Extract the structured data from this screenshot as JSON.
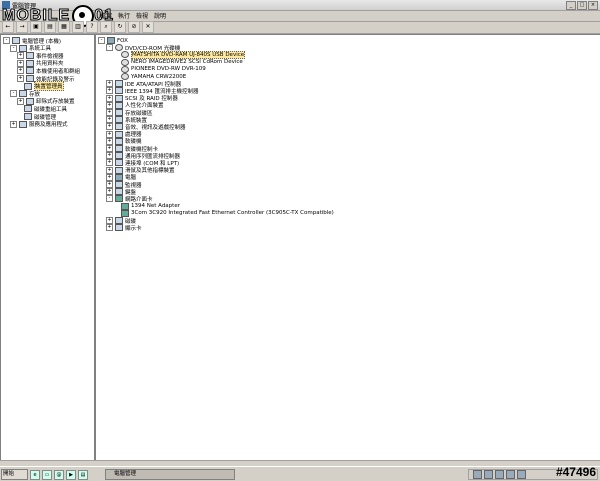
{
  "window": {
    "title": "電腦管理"
  },
  "logo": {
    "text": "MOBILE",
    "suffix": "01"
  },
  "menu": [
    "檔案",
    "執行",
    "檢視",
    "說明"
  ],
  "left_tree": [
    {
      "label": "電腦管理 (本機)",
      "level": 0,
      "exp": "-"
    },
    {
      "label": "系統工具",
      "level": 1,
      "exp": "-"
    },
    {
      "label": "事件檢視器",
      "level": 2,
      "exp": "+"
    },
    {
      "label": "共用資料夾",
      "level": 2,
      "exp": "+"
    },
    {
      "label": "本機使用者和群組",
      "level": 2,
      "exp": "+"
    },
    {
      "label": "效能記錄及警示",
      "level": 2,
      "exp": "+"
    },
    {
      "label": "裝置管理員",
      "level": 2,
      "exp": "",
      "selected": true
    },
    {
      "label": "存放",
      "level": 1,
      "exp": "-"
    },
    {
      "label": "卸除式存放裝置",
      "level": 2,
      "exp": "+"
    },
    {
      "label": "磁碟重組工具",
      "level": 2,
      "exp": ""
    },
    {
      "label": "磁碟管理",
      "level": 2,
      "exp": ""
    },
    {
      "label": "服務及應用程式",
      "level": 1,
      "exp": "+"
    }
  ],
  "right_tree": [
    {
      "label": "FOX",
      "level": 0,
      "exp": "-",
      "icon": "comp"
    },
    {
      "label": "DVD/CD-ROM 光碟機",
      "level": 1,
      "exp": "-",
      "icon": "disc"
    },
    {
      "label": "MATSHITA DVD-RAM UJ-840S USB Device",
      "level": 2,
      "exp": "",
      "icon": "disc",
      "selected": true
    },
    {
      "label": "NERO IMAGEDRIVE2 SCSI CdRom Device",
      "level": 2,
      "exp": "",
      "icon": "disc"
    },
    {
      "label": "PIONEER DVD-RW  DVR-109",
      "level": 2,
      "exp": "",
      "icon": "disc"
    },
    {
      "label": "YAMAHA CRW2200E",
      "level": 2,
      "exp": "",
      "icon": "disc"
    },
    {
      "label": "IDE ATA/ATAPI 控制器",
      "level": 1,
      "exp": "+"
    },
    {
      "label": "IEEE 1394 匯流排主機控制器",
      "level": 1,
      "exp": "+"
    },
    {
      "label": "SCSI 及 RAID 控制器",
      "level": 1,
      "exp": "+"
    },
    {
      "label": "人性化介面裝置",
      "level": 1,
      "exp": "+"
    },
    {
      "label": "存放磁碟區",
      "level": 1,
      "exp": "+"
    },
    {
      "label": "系統裝置",
      "level": 1,
      "exp": "+"
    },
    {
      "label": "音效、視訊及遊戲控制器",
      "level": 1,
      "exp": "+"
    },
    {
      "label": "處理器",
      "level": 1,
      "exp": "+"
    },
    {
      "label": "軟碟機",
      "level": 1,
      "exp": "+"
    },
    {
      "label": "軟碟機控制卡",
      "level": 1,
      "exp": "+"
    },
    {
      "label": "通用序列匯流排控制器",
      "level": 1,
      "exp": "+"
    },
    {
      "label": "連接埠 (COM 和 LPT)",
      "level": 1,
      "exp": "+"
    },
    {
      "label": "滑鼠及其他指標裝置",
      "level": 1,
      "exp": "+"
    },
    {
      "label": "電腦",
      "level": 1,
      "exp": "+",
      "icon": "comp"
    },
    {
      "label": "監視器",
      "level": 1,
      "exp": "+"
    },
    {
      "label": "鍵盤",
      "level": 1,
      "exp": "+"
    },
    {
      "label": "網路介面卡",
      "level": 1,
      "exp": "-",
      "icon": "net"
    },
    {
      "label": "1394 Net Adapter",
      "level": 2,
      "exp": "",
      "icon": "net"
    },
    {
      "label": "3Com 3C920 Integrated Fast Ethernet Controller (3C905C-TX Compatible)",
      "level": 2,
      "exp": "",
      "icon": "net"
    },
    {
      "label": "磁碟",
      "level": 1,
      "exp": "+"
    },
    {
      "label": "顯示卡",
      "level": 1,
      "exp": "+"
    }
  ],
  "taskbar": {
    "start": "開始",
    "task": "電腦管理"
  },
  "watermark": "#47496",
  "colors": {
    "selection": "#ffe9a0",
    "pane_bg": "#ffffff",
    "chrome": "#d4d0c8"
  }
}
